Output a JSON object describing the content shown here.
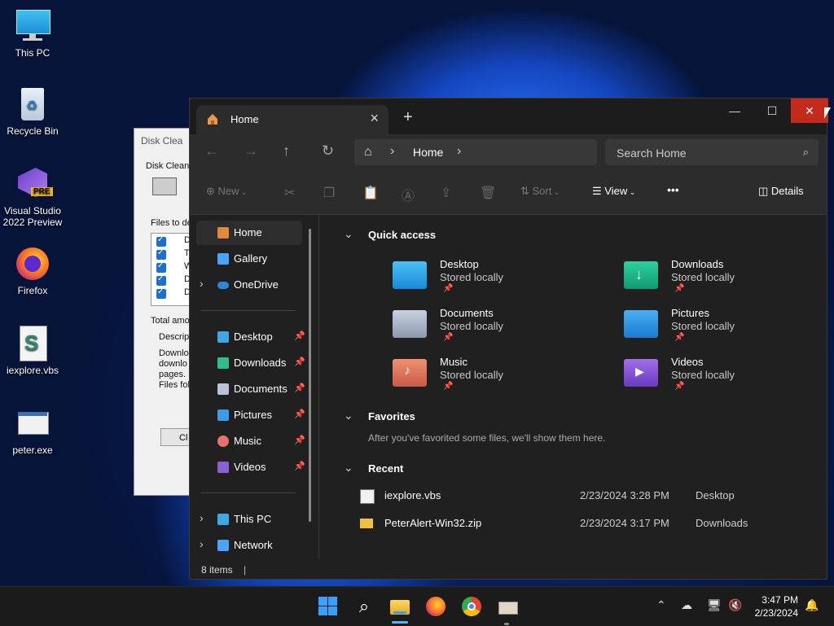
{
  "desktop": {
    "icons": [
      {
        "label": "This PC",
        "icon": "monitor-icon"
      },
      {
        "label": "Recycle Bin",
        "icon": "recycle-bin-icon"
      },
      {
        "label": "Visual Studio 2022 Preview",
        "icon": "visual-studio-icon",
        "badge": "PRE"
      },
      {
        "label": "Firefox",
        "icon": "firefox-icon"
      },
      {
        "label": "iexplore.vbs",
        "icon": "script-icon"
      },
      {
        "label": "peter.exe",
        "icon": "exe-icon"
      }
    ]
  },
  "disk_cleanup": {
    "title": "Disk Clea",
    "label1": "Disk Cleanu",
    "files_label": "Files to de",
    "total_label": "Total amo",
    "desc_label": "Descripti",
    "desc_text": [
      "Downlo",
      "downlo",
      "pages.",
      "Files fol"
    ],
    "clean_button": "Cl",
    "items": [
      "D",
      "T",
      "W",
      "D",
      "D"
    ]
  },
  "explorer": {
    "tab_title": "Home",
    "tab_close": "×",
    "new_tab": "+",
    "window_controls": {
      "minimize": "—",
      "maximize": "☐",
      "close": "✕",
      "close_color": "#c42b1c"
    },
    "breadcrumb": {
      "current": "Home"
    },
    "search": {
      "placeholder": "Search Home"
    },
    "command_bar": {
      "new_label": "New",
      "sort_label": "Sort",
      "view_label": "View",
      "more_label": "•••",
      "details_label": "Details"
    },
    "sidebar": {
      "top": [
        {
          "label": "Home",
          "color": "#e08a3c",
          "selected": true
        },
        {
          "label": "Gallery",
          "color": "#4aa3ff"
        },
        {
          "label": "OneDrive",
          "color": "#2b88d8",
          "expandable": true
        }
      ],
      "pinned": [
        {
          "label": "Desktop",
          "color": "#3fa7e6"
        },
        {
          "label": "Downloads",
          "color": "#2fbf8a"
        },
        {
          "label": "Documents",
          "color": "#b8c4d4"
        },
        {
          "label": "Pictures",
          "color": "#3a9ee8"
        },
        {
          "label": "Music",
          "color": "#e8736a"
        },
        {
          "label": "Videos",
          "color": "#8b5fd6"
        }
      ],
      "bottom": [
        {
          "label": "This PC",
          "color": "#3fa7e6"
        },
        {
          "label": "Network",
          "color": "#4aa3ff"
        }
      ]
    },
    "quick_access": {
      "title": "Quick access",
      "items": [
        {
          "name": "Desktop",
          "status": "Stored locally",
          "color": "#2a9de0"
        },
        {
          "name": "Downloads",
          "status": "Stored locally",
          "color": "#18b08a"
        },
        {
          "name": "Documents",
          "status": "Stored locally",
          "color": "#9aa8bb"
        },
        {
          "name": "Pictures",
          "status": "Stored locally",
          "color": "#2b8fe0"
        },
        {
          "name": "Music",
          "status": "Stored locally",
          "color": "#e0705a"
        },
        {
          "name": "Videos",
          "status": "Stored locally",
          "color": "#7a4fcf"
        }
      ]
    },
    "favorites": {
      "title": "Favorites",
      "empty_text": "After you've favorited some files, we'll show them here."
    },
    "recent": {
      "title": "Recent",
      "items": [
        {
          "name": "iexplore.vbs",
          "date": "2/23/2024 3:28 PM",
          "location": "Desktop",
          "icon": "script-icon"
        },
        {
          "name": "PeterAlert-Win32.zip",
          "date": "2/23/2024 3:17 PM",
          "location": "Downloads",
          "icon": "zip-folder-icon"
        }
      ]
    },
    "status": {
      "count": "8 items"
    }
  },
  "taskbar": {
    "apps": [
      "start-icon",
      "search-icon",
      "file-explorer-icon",
      "firefox-icon",
      "chrome-icon",
      "installer-icon"
    ],
    "clock": {
      "time": "3:47 PM",
      "date": "2/23/2024"
    }
  }
}
